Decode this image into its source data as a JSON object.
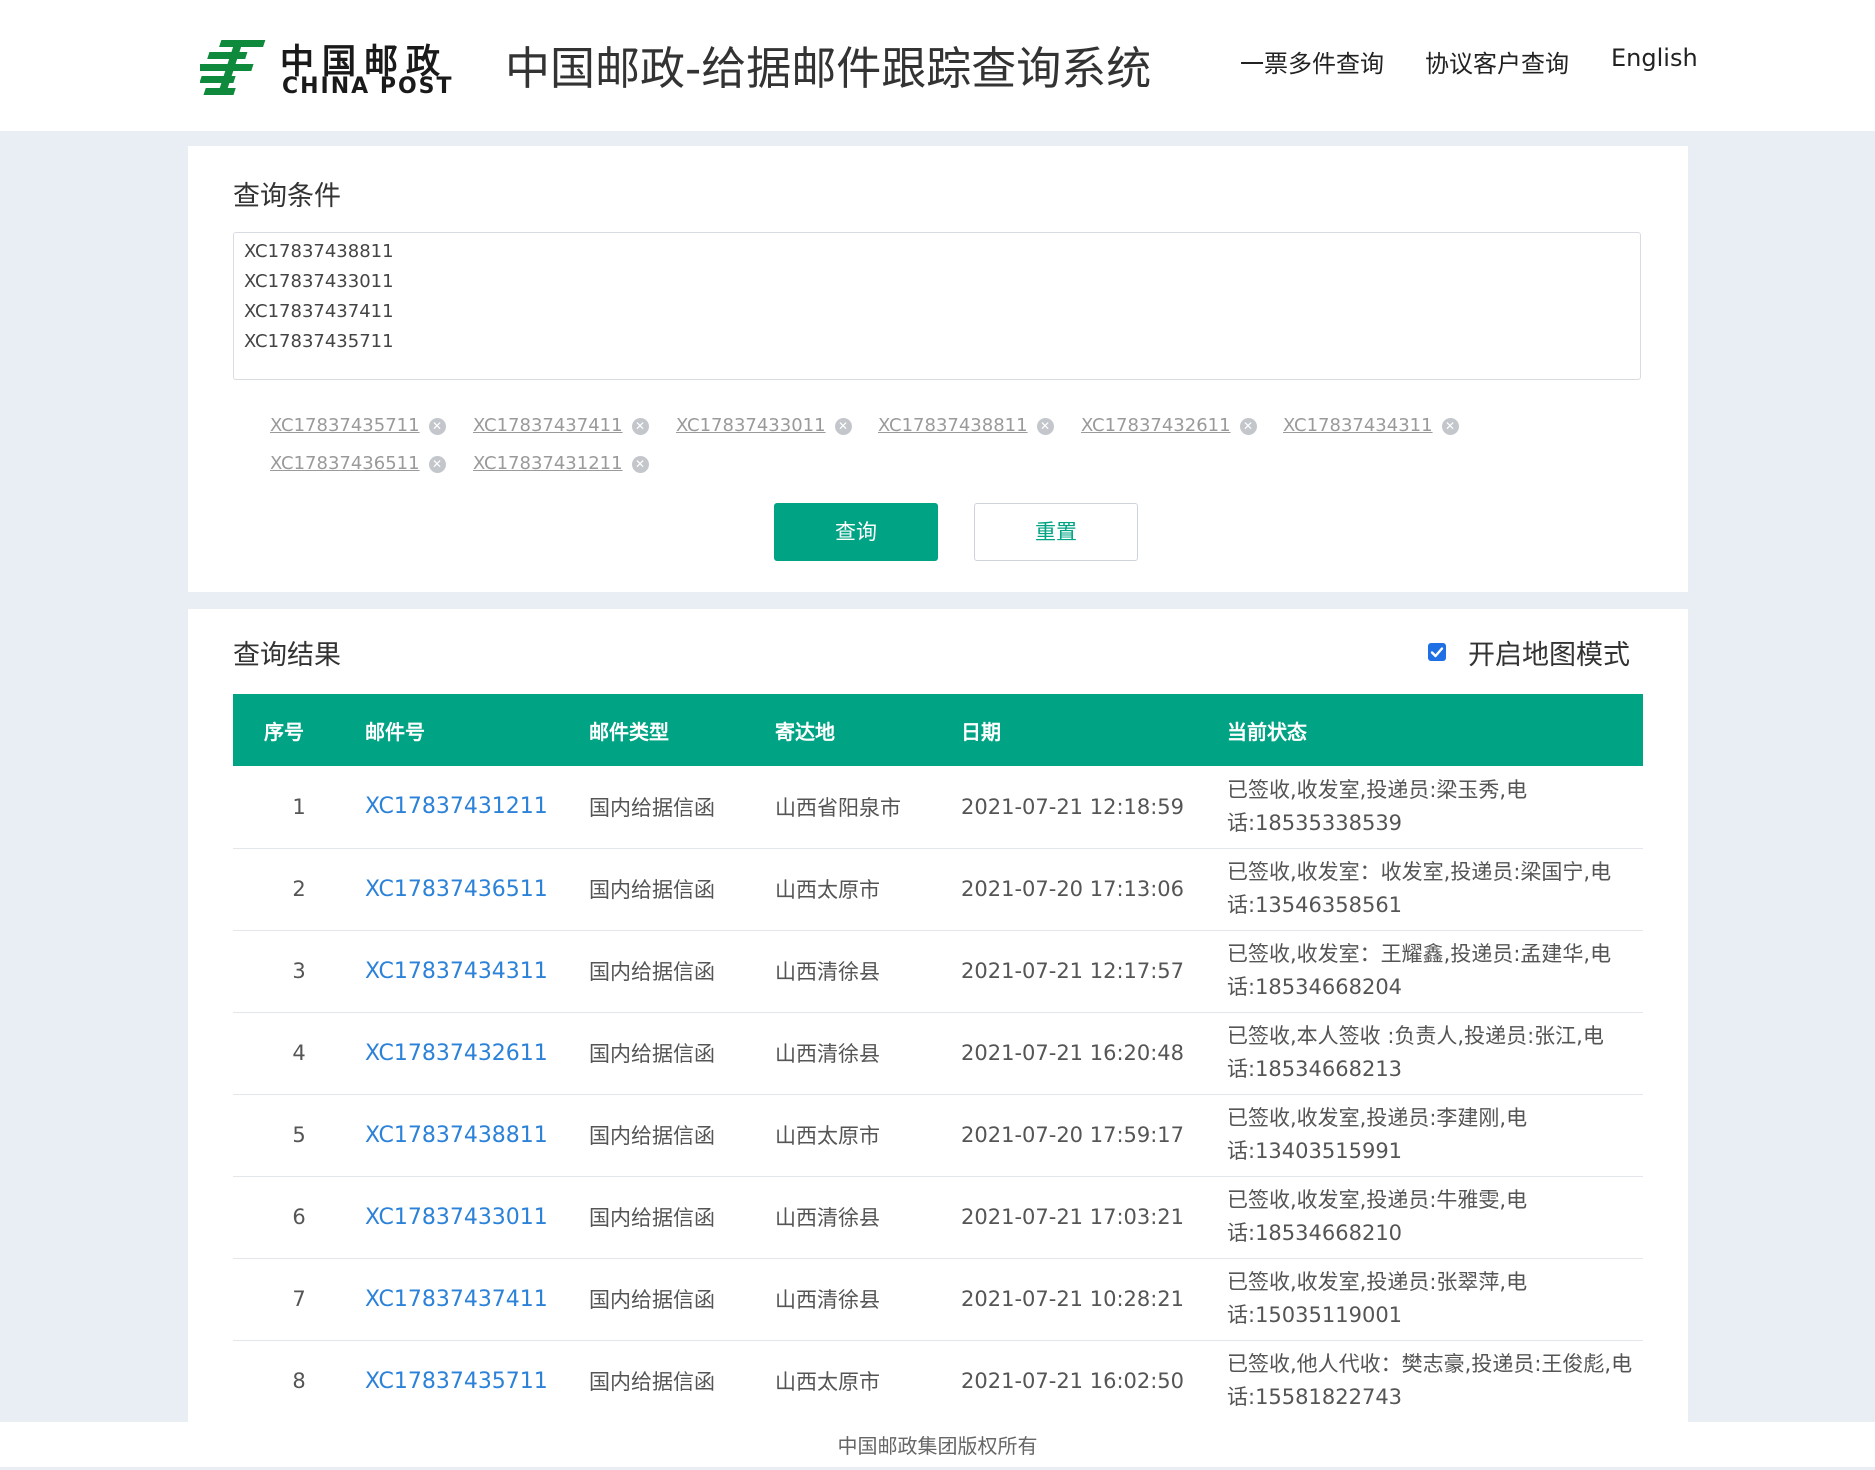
{
  "header": {
    "logo_cn": "中国邮政",
    "logo_en": "CHINA POST",
    "title": "中国邮政-给据邮件跟踪查询系统",
    "nav": [
      "一票多件查询",
      "协议客户查询",
      "English"
    ],
    "brand_color": "#00a383"
  },
  "query": {
    "title": "查询条件",
    "textarea_lines": [
      "XC17837438811",
      "XC17837433011",
      "XC17837437411",
      "XC17837435711"
    ],
    "tags": [
      "XC17837435711",
      "XC17837437411",
      "XC17837433011",
      "XC17837438811",
      "XC17837432611",
      "XC17837434311",
      "XC17837436511",
      "XC17837431211"
    ],
    "query_button": "查询",
    "reset_button": "重置"
  },
  "results": {
    "title": "查询结果",
    "map_mode_label": "开启地图模式",
    "map_mode_checked": true,
    "columns": [
      "序号",
      "邮件号",
      "邮件类型",
      "寄达地",
      "日期",
      "当前状态"
    ],
    "rows": [
      {
        "no": "1",
        "id": "XC17837431211",
        "type": "国内给据信函",
        "dest": "山西省阳泉市",
        "date": "2021-07-21 12:18:59",
        "status": "已签收,收发室,投递员:梁玉秀,电话:18535338539"
      },
      {
        "no": "2",
        "id": "XC17837436511",
        "type": "国内给据信函",
        "dest": "山西太原市",
        "date": "2021-07-20 17:13:06",
        "status": "已签收,收发室：收发室,投递员:梁国宁,电话:13546358561"
      },
      {
        "no": "3",
        "id": "XC17837434311",
        "type": "国内给据信函",
        "dest": "山西清徐县",
        "date": "2021-07-21 12:17:57",
        "status": "已签收,收发室：王耀鑫,投递员:孟建华,电话:18534668204"
      },
      {
        "no": "4",
        "id": "XC17837432611",
        "type": "国内给据信函",
        "dest": "山西清徐县",
        "date": "2021-07-21 16:20:48",
        "status": "已签收,本人签收 :负责人,投递员:张江,电话:18534668213"
      },
      {
        "no": "5",
        "id": "XC17837438811",
        "type": "国内给据信函",
        "dest": "山西太原市",
        "date": "2021-07-20 17:59:17",
        "status": "已签收,收发室,投递员:李建刚,电话:13403515991"
      },
      {
        "no": "6",
        "id": "XC17837433011",
        "type": "国内给据信函",
        "dest": "山西清徐县",
        "date": "2021-07-21 17:03:21",
        "status": "已签收,收发室,投递员:牛雅雯,电话:18534668210"
      },
      {
        "no": "7",
        "id": "XC17837437411",
        "type": "国内给据信函",
        "dest": "山西清徐县",
        "date": "2021-07-21 10:28:21",
        "status": "已签收,收发室,投递员:张翠萍,电话:15035119001"
      },
      {
        "no": "8",
        "id": "XC17837435711",
        "type": "国内给据信函",
        "dest": "山西太原市",
        "date": "2021-07-21 16:02:50",
        "status": "已签收,他人代收：樊志豪,投递员:王俊彪,电话:15581822743"
      }
    ]
  },
  "footer": {
    "text": "中国邮政集团版权所有"
  }
}
